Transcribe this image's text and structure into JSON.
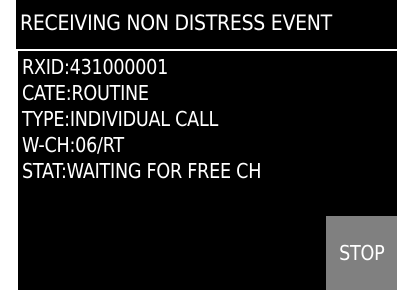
{
  "header": {
    "title": "RECEIVING NON DISTRESS EVENT"
  },
  "info": {
    "lines": [
      "RXID:431000001",
      "CATE:ROUTINE",
      "TYPE:INDIVIDUAL CALL",
      "W-CH:06/RT",
      "STAT:WAITING FOR FREE CH"
    ]
  },
  "actions": {
    "stop_label": "STOP"
  },
  "colors": {
    "background": "#000000",
    "text": "#ffffff",
    "button": "#808080",
    "frame": "#ffffff"
  }
}
